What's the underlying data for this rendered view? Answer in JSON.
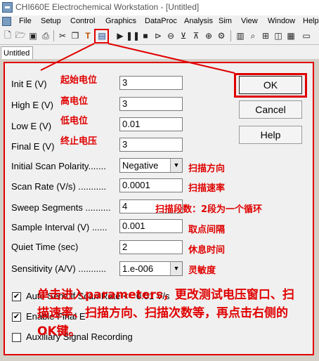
{
  "window": {
    "title": "CHI660E Electrochemical Workstation - [Untitled]"
  },
  "menu": [
    "File",
    "Setup",
    "Control",
    "Graphics",
    "DataProc",
    "Analysis",
    "Sim",
    "View",
    "Window",
    "Help"
  ],
  "toolbar": {
    "icons": [
      "new-file-icon",
      "open-icon",
      "save-icon",
      "print-icon",
      "technique-icon",
      "parameters-icon",
      "run-icon",
      "pause-icon",
      "stop-icon",
      "reverse-icon",
      "filter-icon",
      "zoom-icon",
      "settings-icon"
    ]
  },
  "tab": {
    "label": "Untitled"
  },
  "form": {
    "init_e": {
      "label": "Init E (V)",
      "value": "3"
    },
    "high_e": {
      "label": "High E (V)",
      "value": "3"
    },
    "low_e": {
      "label": "Low E (V)",
      "value": "0.01"
    },
    "final_e": {
      "label": "Final E (V)",
      "value": "3"
    },
    "polarity": {
      "label": "Initial Scan Polarity.......",
      "value": "Negative"
    },
    "scan_rate": {
      "label": "Scan Rate (V/s) ...........",
      "value": "0.0001"
    },
    "sweep_segments": {
      "label": "Sweep Segments ..........",
      "value": "4"
    },
    "sample_interval": {
      "label": "Sample Interval (V) ......",
      "value": "0.001"
    },
    "quiet_time": {
      "label": "Quiet Time (sec)",
      "value": "2"
    },
    "sensitivity": {
      "label": "Sensitivity (A/V) ...........",
      "value": "1.e-006"
    }
  },
  "buttons": {
    "ok": "OK",
    "cancel": "Cancel",
    "help": "Help"
  },
  "checkboxes": [
    {
      "label": "Auto Sens if Scan Rate <= 0.01 V/s",
      "checked": true
    },
    {
      "label": "Enable Final E",
      "checked": true
    },
    {
      "label": "Auxiliary Signal Recording",
      "checked": false
    }
  ],
  "annotations": {
    "init_e": "起始电位",
    "high_e": "高电位",
    "low_e": "低电位",
    "final_e": "终止电压",
    "polarity": "扫描方向",
    "scan_rate": "扫描速率",
    "sweep_segments": "扫描段数：2段为一个循环",
    "sample_interval": "取点间隔",
    "quiet_time": "休息时间",
    "sensitivity": "灵敏度",
    "instruction": "单击进入parameters，更改测试电压窗口、扫描速率、扫描方向、扫描次数等，再点击右侧的OK键。"
  },
  "colors": {
    "accent": "#e00000"
  }
}
